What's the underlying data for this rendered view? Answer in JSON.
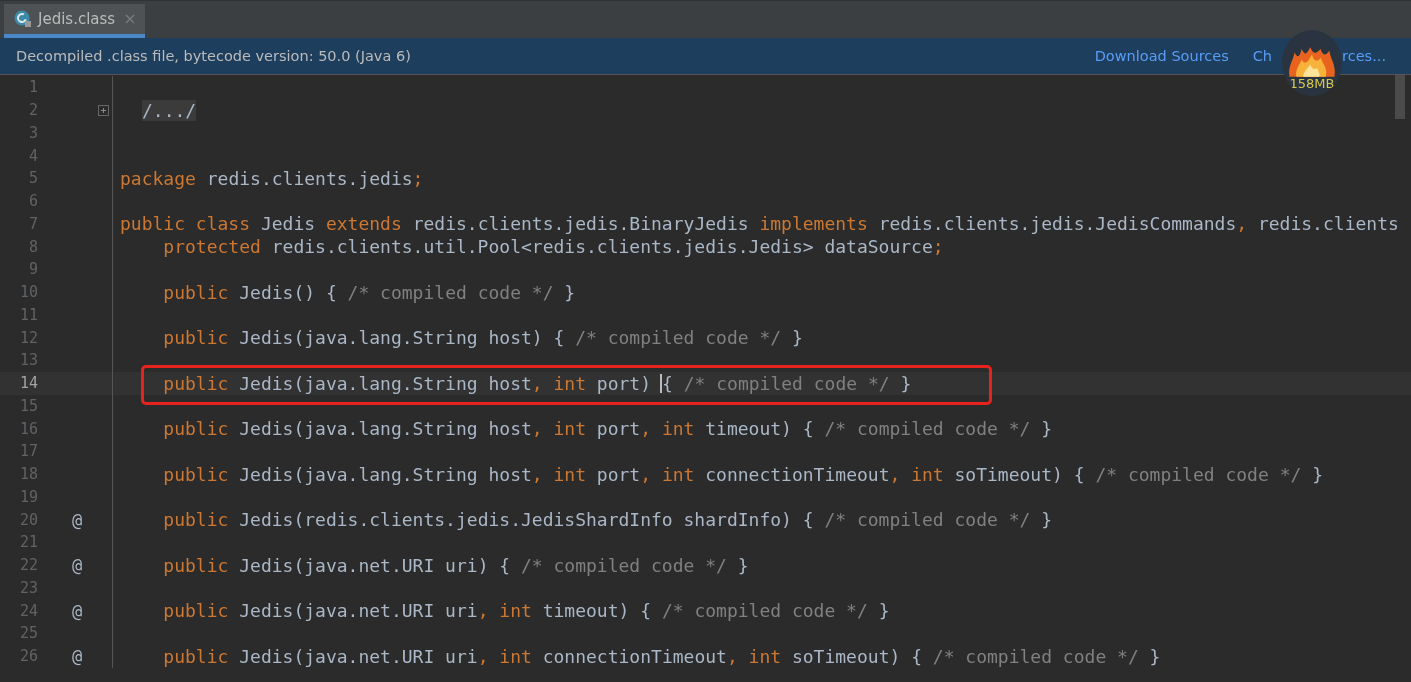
{
  "tabs": [
    {
      "label": "Jedis.class",
      "selected": true
    }
  ],
  "info_bar": {
    "message": "Decompiled .class file, bytecode version: 50.0 (Java 6)",
    "links": [
      {
        "parts": [
          "Download Sources"
        ]
      },
      {
        "parts": [
          "Ch",
          "rces..."
        ]
      }
    ]
  },
  "memory_indicator": {
    "label": "158MB"
  },
  "editor": {
    "lines": [
      {
        "number": "1"
      },
      {
        "number": "2",
        "fold": true,
        "tokens": [
          {
            "kind": "folded",
            "text": "/.../"
          }
        ]
      },
      {
        "number": "3"
      },
      {
        "number": "4"
      },
      {
        "number": "5",
        "tokens": [
          {
            "kind": "keyword",
            "text": "package "
          },
          {
            "kind": "plain",
            "text": "redis.clients.jedis"
          },
          {
            "kind": "keyword",
            "text": ";"
          }
        ]
      },
      {
        "number": "6"
      },
      {
        "number": "7",
        "tokens": [
          {
            "kind": "keyword",
            "text": "public class "
          },
          {
            "kind": "plain",
            "text": "Jedis "
          },
          {
            "kind": "keyword",
            "text": "extends "
          },
          {
            "kind": "plain",
            "text": "redis.clients.jedis.BinaryJedis "
          },
          {
            "kind": "keyword",
            "text": "implements "
          },
          {
            "kind": "plain",
            "text": "redis.clients.jedis.JedisCommands"
          },
          {
            "kind": "keyword",
            "text": ", "
          },
          {
            "kind": "plain",
            "text": "redis.clients"
          }
        ]
      },
      {
        "number": "8",
        "tokens": [
          {
            "kind": "keyword",
            "text": "    protected "
          },
          {
            "kind": "plain",
            "text": "redis.clients.util.Pool<redis.clients.jedis.Jedis> dataSource"
          },
          {
            "kind": "keyword",
            "text": ";"
          }
        ]
      },
      {
        "number": "9"
      },
      {
        "number": "10",
        "tokens": [
          {
            "kind": "keyword",
            "text": "    public "
          },
          {
            "kind": "plain",
            "text": "Jedis() { "
          },
          {
            "kind": "comment",
            "text": "/* compiled code */"
          },
          {
            "kind": "plain",
            "text": " }"
          }
        ]
      },
      {
        "number": "11"
      },
      {
        "number": "12",
        "tokens": [
          {
            "kind": "keyword",
            "text": "    public "
          },
          {
            "kind": "plain",
            "text": "Jedis(java.lang.String host) { "
          },
          {
            "kind": "comment",
            "text": "/* compiled code */"
          },
          {
            "kind": "plain",
            "text": " }"
          }
        ]
      },
      {
        "number": "13"
      },
      {
        "number": "14",
        "current": true,
        "highlight": true,
        "tokens": [
          {
            "kind": "keyword",
            "text": "    public "
          },
          {
            "kind": "plain",
            "text": "Jedis(java.lang.String host"
          },
          {
            "kind": "keyword",
            "text": ", int "
          },
          {
            "kind": "plain",
            "text": "port)"
          },
          {
            "kind": "caret"
          },
          {
            "kind": "plain",
            "text": "{ "
          },
          {
            "kind": "comment",
            "text": "/* compiled code */"
          },
          {
            "kind": "plain",
            "text": " }"
          }
        ]
      },
      {
        "number": "15"
      },
      {
        "number": "16",
        "tokens": [
          {
            "kind": "keyword",
            "text": "    public "
          },
          {
            "kind": "plain",
            "text": "Jedis(java.lang.String host"
          },
          {
            "kind": "keyword",
            "text": ", int "
          },
          {
            "kind": "plain",
            "text": "port"
          },
          {
            "kind": "keyword",
            "text": ", int "
          },
          {
            "kind": "plain",
            "text": "timeout) { "
          },
          {
            "kind": "comment",
            "text": "/* compiled code */"
          },
          {
            "kind": "plain",
            "text": " }"
          }
        ]
      },
      {
        "number": "17"
      },
      {
        "number": "18",
        "tokens": [
          {
            "kind": "keyword",
            "text": "    public "
          },
          {
            "kind": "plain",
            "text": "Jedis(java.lang.String host"
          },
          {
            "kind": "keyword",
            "text": ", int "
          },
          {
            "kind": "plain",
            "text": "port"
          },
          {
            "kind": "keyword",
            "text": ", int "
          },
          {
            "kind": "plain",
            "text": "connectionTimeout"
          },
          {
            "kind": "keyword",
            "text": ", int "
          },
          {
            "kind": "plain",
            "text": "soTimeout) { "
          },
          {
            "kind": "comment",
            "text": "/* compiled code */"
          },
          {
            "kind": "plain",
            "text": " }"
          }
        ]
      },
      {
        "number": "19"
      },
      {
        "number": "20",
        "marker": "@",
        "tokens": [
          {
            "kind": "keyword",
            "text": "    public "
          },
          {
            "kind": "plain",
            "text": "Jedis(redis.clients.jedis.JedisShardInfo shardInfo) { "
          },
          {
            "kind": "comment",
            "text": "/* compiled code */"
          },
          {
            "kind": "plain",
            "text": " }"
          }
        ]
      },
      {
        "number": "21"
      },
      {
        "number": "22",
        "marker": "@",
        "tokens": [
          {
            "kind": "keyword",
            "text": "    public "
          },
          {
            "kind": "plain",
            "text": "Jedis(java.net.URI uri) { "
          },
          {
            "kind": "comment",
            "text": "/* compiled code */"
          },
          {
            "kind": "plain",
            "text": " }"
          }
        ]
      },
      {
        "number": "23"
      },
      {
        "number": "24",
        "marker": "@",
        "tokens": [
          {
            "kind": "keyword",
            "text": "    public "
          },
          {
            "kind": "plain",
            "text": "Jedis(java.net.URI uri"
          },
          {
            "kind": "keyword",
            "text": ", int "
          },
          {
            "kind": "plain",
            "text": "timeout) { "
          },
          {
            "kind": "comment",
            "text": "/* compiled code */"
          },
          {
            "kind": "plain",
            "text": " }"
          }
        ]
      },
      {
        "number": "25"
      },
      {
        "number": "26",
        "marker": "@",
        "tokens": [
          {
            "kind": "keyword",
            "text": "    public "
          },
          {
            "kind": "plain",
            "text": "Jedis(java.net.URI uri"
          },
          {
            "kind": "keyword",
            "text": ", int "
          },
          {
            "kind": "plain",
            "text": "connectionTimeout"
          },
          {
            "kind": "keyword",
            "text": ", int "
          },
          {
            "kind": "plain",
            "text": "soTimeout) { "
          },
          {
            "kind": "comment",
            "text": "/* compiled code */"
          },
          {
            "kind": "plain",
            "text": " }"
          }
        ]
      }
    ]
  }
}
